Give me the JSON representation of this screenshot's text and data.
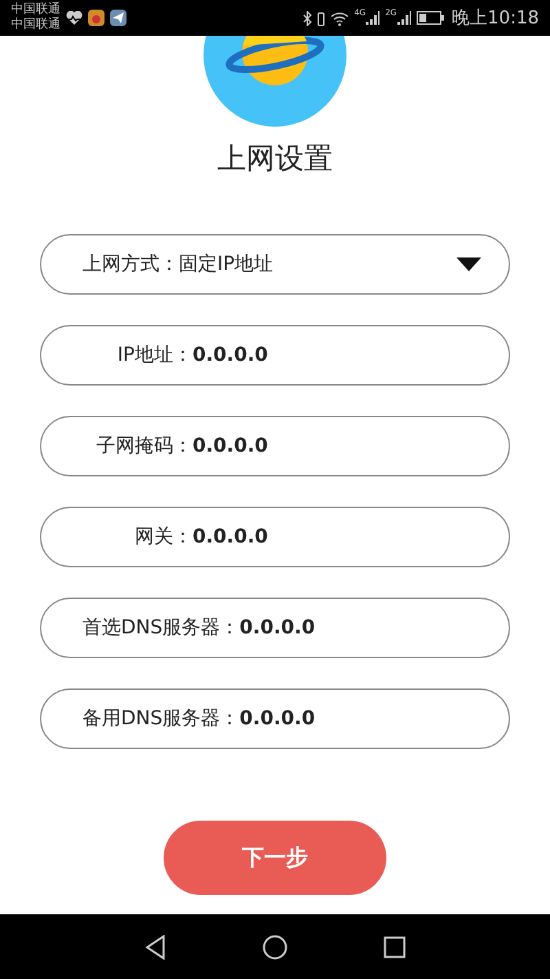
{
  "status_bar": {
    "carriers": [
      "中国联通",
      "中国联通"
    ],
    "network_1": "4G",
    "network_2": "2G",
    "time": "晚上10:18"
  },
  "title": "上网设置",
  "fields": [
    {
      "kind": "select",
      "label": "上网方式：",
      "value": "固定IP地址"
    },
    {
      "kind": "text",
      "label": "IP地址：",
      "value": "0.0.0.0"
    },
    {
      "kind": "text",
      "label": "子网掩码：",
      "value": "0.0.0.0"
    },
    {
      "kind": "text",
      "label": "网关：",
      "value": "0.0.0.0"
    },
    {
      "kind": "text",
      "label": "首选DNS服务器：",
      "value": "0.0.0.0"
    },
    {
      "kind": "text",
      "label": "备用DNS服务器：",
      "value": "0.0.0.0"
    }
  ],
  "next_button": "下一步"
}
